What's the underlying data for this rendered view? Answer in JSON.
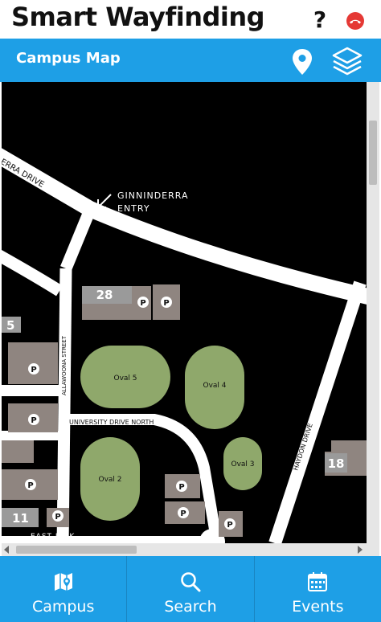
{
  "header": {
    "title": "Smart Wayfinding",
    "help_glyph": "?"
  },
  "subbar": {
    "title": "Campus Map"
  },
  "map": {
    "roads": {
      "ginninderra_drive": "ERRA DRIVE",
      "ginninderra_entry_line1": "GINNINDERRA",
      "ginninderra_entry_line2": "ENTRY",
      "allawoona_street": "ALLAWOONA STREET",
      "university_drive_north": "UNIVERSITY DRIVE NORTH",
      "haydon_drive": "HAYDON DRIVE",
      "east_link": "EAST LINK"
    },
    "buildings": [
      "28",
      "5",
      "11",
      "18"
    ],
    "ovals": [
      "Oval 5",
      "Oval 4",
      "Oval 3",
      "Oval 2"
    ],
    "parking_glyph": "P"
  },
  "nav": [
    {
      "label": "Campus",
      "icon": "map-icon"
    },
    {
      "label": "Search",
      "icon": "search-icon"
    },
    {
      "label": "Events",
      "icon": "calendar-icon"
    }
  ],
  "colors": {
    "accent": "#1e9fe6",
    "map_bg": "#000000",
    "road": "#ffffff",
    "oval": "#8fa86b",
    "building": "#8f8580"
  }
}
